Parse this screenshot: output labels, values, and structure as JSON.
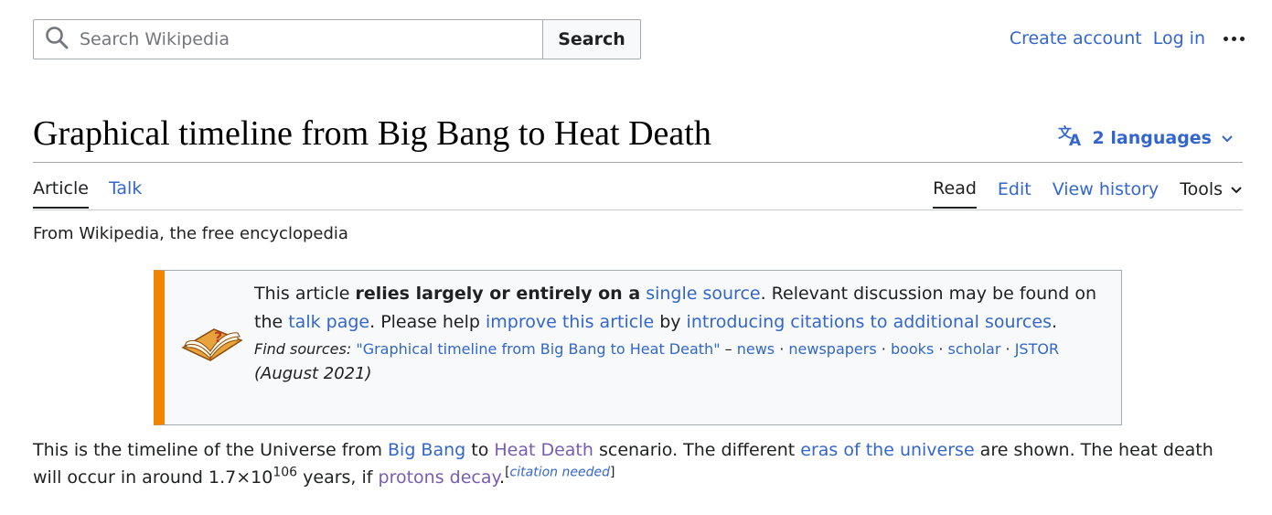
{
  "header": {
    "search_placeholder": "Search Wikipedia",
    "search_button": "Search",
    "create_account": "Create account",
    "log_in": "Log in"
  },
  "page": {
    "title": "Graphical timeline from Big Bang to Heat Death",
    "languages": "2 languages",
    "tagline": "From Wikipedia, the free encyclopedia"
  },
  "tabs": {
    "article": "Article",
    "talk": "Talk",
    "read": "Read",
    "edit": "Edit",
    "view_history": "View history",
    "tools": "Tools"
  },
  "ambox": {
    "t1": "This article ",
    "bold": "relies largely or entirely on a",
    "t2": " ",
    "link_single_source": "single source",
    "t3": ". Relevant discussion may be found on the ",
    "link_talk_page": "talk page",
    "t4": ". Please help ",
    "link_improve": "improve this article",
    "t5": " by ",
    "link_introducing": "introducing citations to additional sources",
    "t6": ".",
    "find_label": "Find sources:",
    "find_query": "\"Graphical timeline from Big Bang to Heat Death\"",
    "dash": " – ",
    "src_news": "news",
    "src_newspapers": "newspapers",
    "src_books": "books",
    "src_scholar": "scholar",
    "src_jstor": "JSTOR",
    "sep": " · ",
    "date": "(August 2021)"
  },
  "body": {
    "p1": "This is the timeline of the Universe from ",
    "link_big_bang": "Big Bang",
    "p2": " to ",
    "link_heat_death": "Heat Death",
    "p3": " scenario. The different ",
    "link_eras": "eras of the universe",
    "p4": " are shown. The heat death will occur in around 1.7×10",
    "exponent": "106",
    "p5": " years, if ",
    "link_protons": "protons decay",
    "p6": ".",
    "cite_open": "[",
    "cite_text": "citation needed",
    "cite_close": "]"
  },
  "colors": {
    "link": "#3366cc",
    "visited_link": "#795cb2",
    "ambox_stripe": "#f28500"
  }
}
